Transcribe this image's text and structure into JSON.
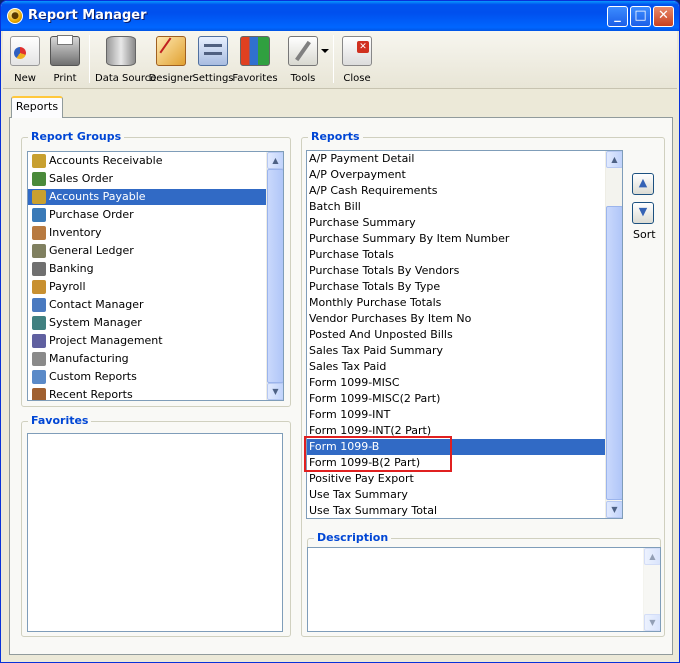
{
  "window": {
    "title": "Report Manager"
  },
  "toolbar": {
    "items": [
      {
        "label": "New",
        "icon": "new-report-icon"
      },
      {
        "label": "Print",
        "icon": "printer-icon"
      },
      {
        "label": "Data Source",
        "icon": "database-icon"
      },
      {
        "label": "Designer",
        "icon": "designer-icon"
      },
      {
        "label": "Settings",
        "icon": "settings-icon"
      },
      {
        "label": "Favorites",
        "icon": "favorites-icon"
      },
      {
        "label": "Tools",
        "icon": "tools-icon"
      },
      {
        "label": "Close",
        "icon": "close-report-icon"
      }
    ]
  },
  "tabs": [
    {
      "label": "Reports"
    }
  ],
  "report_groups": {
    "title": "Report Groups",
    "items": [
      {
        "label": "Accounts Receivable",
        "icon": "accounts-receivable-icon",
        "color": "#c8a030"
      },
      {
        "label": "Sales Order",
        "icon": "sales-order-icon",
        "color": "#4a8a3a"
      },
      {
        "label": "Accounts Payable",
        "icon": "accounts-payable-icon",
        "color": "#c8a030"
      },
      {
        "label": "Purchase Order",
        "icon": "purchase-order-icon",
        "color": "#3a7ab8"
      },
      {
        "label": "Inventory",
        "icon": "inventory-icon",
        "color": "#b87a40"
      },
      {
        "label": "General Ledger",
        "icon": "general-ledger-icon",
        "color": "#808060"
      },
      {
        "label": "Banking",
        "icon": "banking-icon",
        "color": "#707070"
      },
      {
        "label": "Payroll",
        "icon": "payroll-icon",
        "color": "#c89030"
      },
      {
        "label": "Contact Manager",
        "icon": "contact-manager-icon",
        "color": "#4a7ac0"
      },
      {
        "label": "System Manager",
        "icon": "system-manager-icon",
        "color": "#408080"
      },
      {
        "label": "Project Management",
        "icon": "project-management-icon",
        "color": "#6060a0"
      },
      {
        "label": "Manufacturing",
        "icon": "manufacturing-icon",
        "color": "#8a8a8a"
      },
      {
        "label": "Custom Reports",
        "icon": "custom-reports-icon",
        "color": "#5a8ac8"
      },
      {
        "label": "Recent Reports",
        "icon": "recent-reports-icon",
        "color": "#a06030"
      }
    ],
    "selected": "Accounts Payable"
  },
  "favorites": {
    "title": "Favorites"
  },
  "reports": {
    "title": "Reports",
    "items": [
      "A/P Payment Detail",
      "A/P Overpayment",
      "A/P Cash Requirements",
      "Batch Bill",
      "Purchase Summary",
      "Purchase Summary By Item Number",
      "Purchase Totals",
      "Purchase Totals By Vendors",
      "Purchase Totals By Type",
      "Monthly Purchase Totals",
      "Vendor Purchases By Item No",
      "Posted And Unposted Bills",
      "Sales Tax Paid Summary",
      "Sales Tax Paid",
      "Form 1099-MISC",
      "Form 1099-MISC(2 Part)",
      "Form 1099-INT",
      "Form 1099-INT(2 Part)",
      "Form 1099-B",
      "Form 1099-B(2 Part)",
      "Positive Pay Export",
      "Use Tax Summary",
      "Use Tax Summary Total"
    ],
    "selected": "Form 1099-B"
  },
  "sort": {
    "label": "Sort"
  },
  "description": {
    "title": "Description"
  },
  "colors": {
    "selection": "#316ac5",
    "group_title": "#0046d5",
    "highlight": "#e02020"
  }
}
